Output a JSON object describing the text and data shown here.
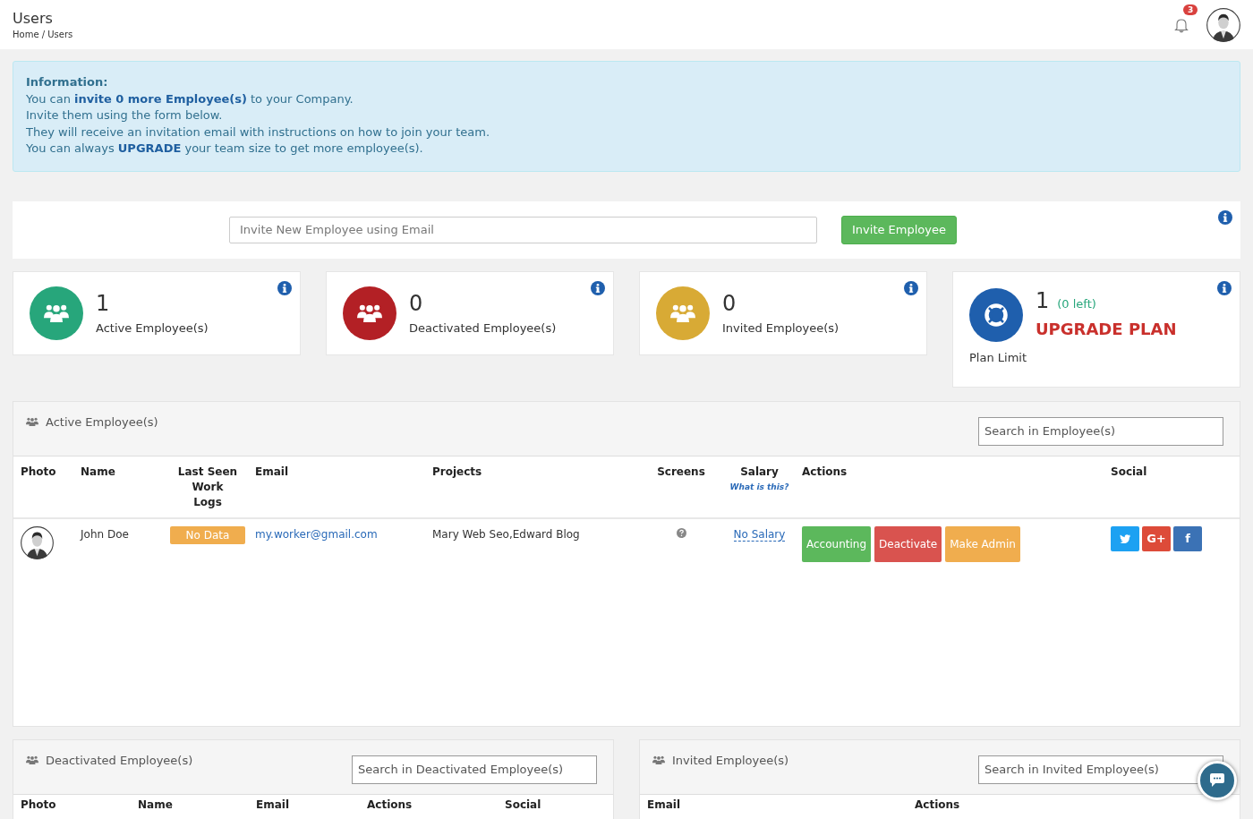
{
  "header": {
    "title": "Users",
    "breadcrumb": "Home / Users",
    "notification_count": "3"
  },
  "info": {
    "heading": "Information:",
    "lines": [
      "You can **invite 0 more Employee(s)** to your Company.",
      "Invite them using the form below.",
      "They will receive an invitation email with instructions on how to join your team.",
      "You can always **UPGRADE** your team size to get more employee(s)."
    ]
  },
  "invite": {
    "placeholder": "Invite New Employee using Email",
    "button": "Invite Employee"
  },
  "stats": [
    {
      "kind": "group",
      "value": "1",
      "label": "Active Employee(s)",
      "color": "#27a67b"
    },
    {
      "kind": "group",
      "value": "0",
      "label": "Deactivated Employee(s)",
      "color": "#b32025"
    },
    {
      "kind": "group",
      "value": "0",
      "label": "Invited Employee(s)",
      "color": "#d8aa35"
    },
    {
      "kind": "plan",
      "value": "1",
      "note": "(0 left)",
      "link": "UPGRADE PLAN",
      "label": "Plan Limit",
      "color": "#1f5fad"
    }
  ],
  "active_panel": {
    "title": "Active Employee(s)",
    "search_placeholder": "Search in Employee(s)",
    "columns": [
      {
        "label": "Photo"
      },
      {
        "label": "Name"
      },
      {
        "label": "Last Seen Work Logs"
      },
      {
        "label": "Email"
      },
      {
        "label": "Projects"
      },
      {
        "label": "Screens"
      },
      {
        "label": "Salary",
        "note": "What is this?"
      },
      {
        "label": "Actions"
      },
      {
        "label": "Social"
      }
    ],
    "rows": [
      {
        "name": "John Doe",
        "last_seen": "No Data",
        "email": "my.worker@gmail.com",
        "projects": "Mary Web Seo,Edward Blog",
        "salary": "No Salary",
        "actions": [
          {
            "kind": "success",
            "label": "Accounting"
          },
          {
            "kind": "danger",
            "label": "Deactivate"
          },
          {
            "kind": "warning",
            "label": "Make Admin"
          }
        ],
        "social": [
          {
            "kind": "twitter"
          },
          {
            "kind": "google",
            "label": "G+"
          },
          {
            "kind": "facebook",
            "label": "f"
          }
        ]
      }
    ]
  },
  "bottom_panels": [
    {
      "title": "Deactivated Employee(s)",
      "search_placeholder": "Search in Deactivated Employee(s)",
      "columns": [
        "Photo",
        "Name",
        "Email",
        "Actions",
        "Social"
      ]
    },
    {
      "title": "Invited Employee(s)",
      "search_placeholder": "Search in Invited Employee(s)",
      "columns": [
        "Email",
        "Actions"
      ]
    }
  ]
}
